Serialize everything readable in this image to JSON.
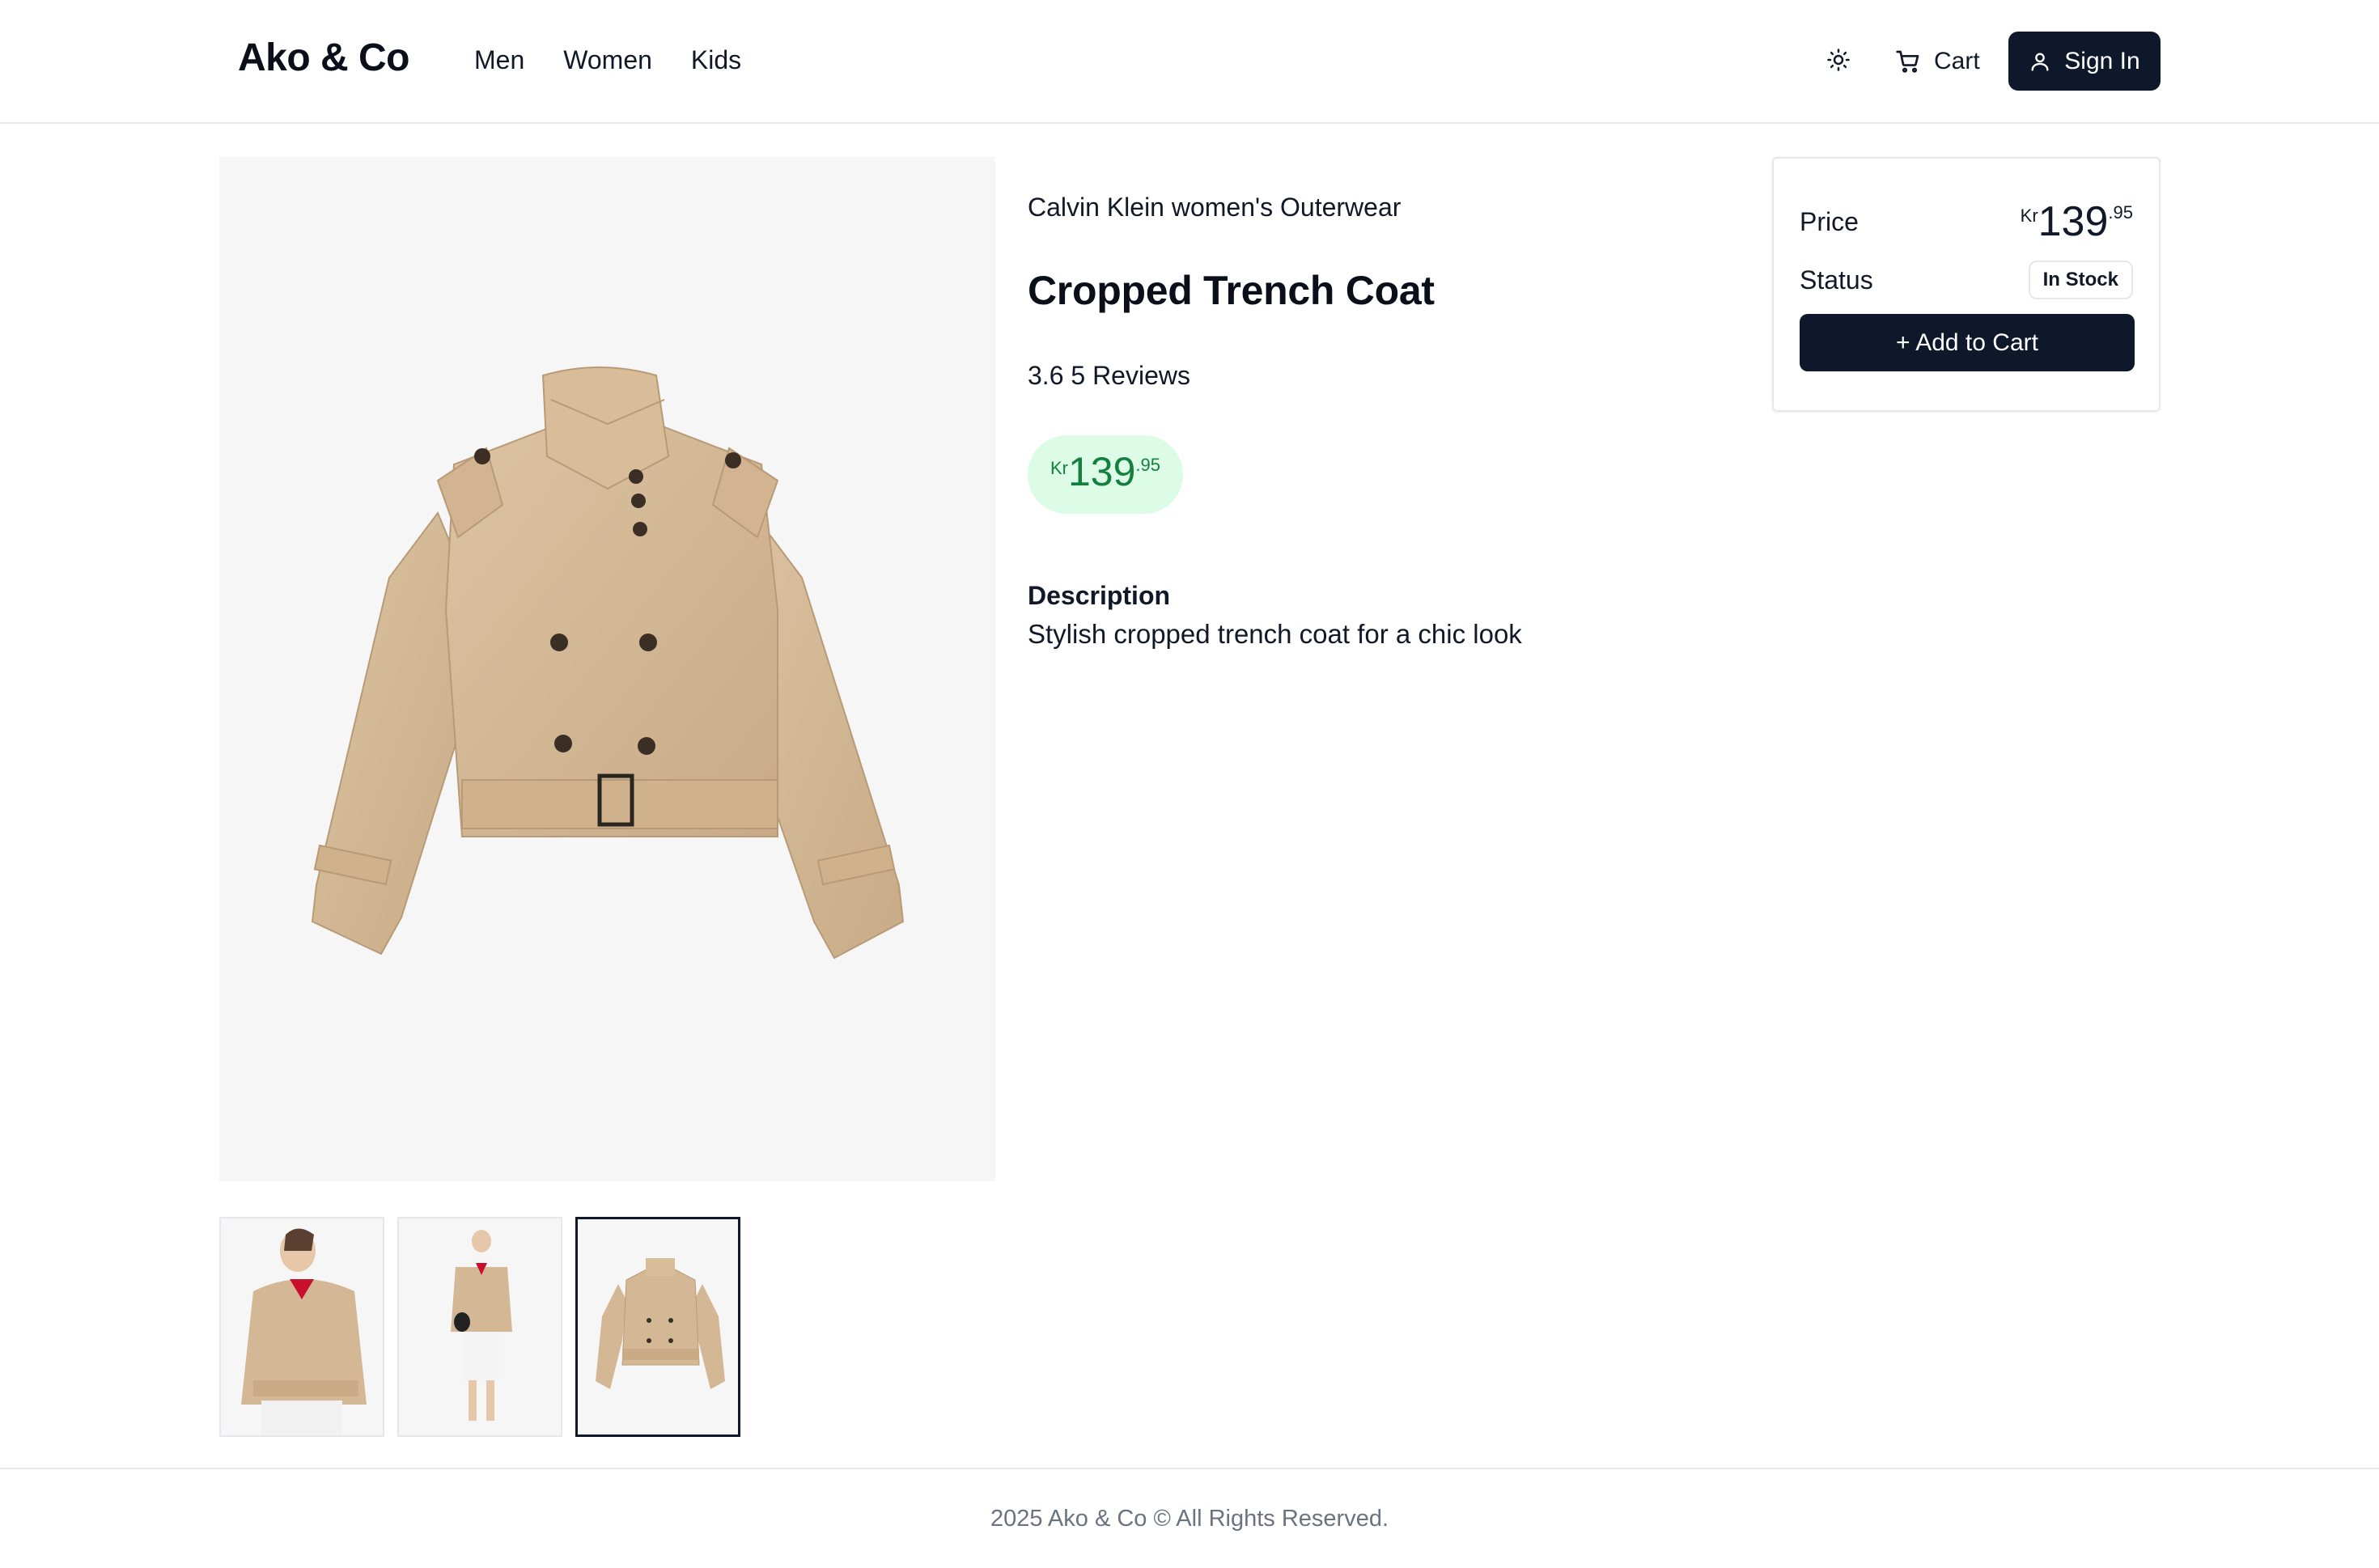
{
  "header": {
    "logo": "Ako & Co",
    "nav": [
      "Men",
      "Women",
      "Kids"
    ],
    "theme_icon": "sun-icon",
    "cart_label": "Cart",
    "cart_icon": "cart-icon",
    "signin_label": "Sign In",
    "signin_icon": "user-icon"
  },
  "product": {
    "brand_line": "Calvin Klein women's Outerwear",
    "title": "Cropped Trench Coat",
    "rating_text": "3.6 5 Reviews",
    "price": {
      "currency": "Kr",
      "whole": "139",
      "fraction": ".95"
    },
    "description_heading": "Description",
    "description": "Stylish cropped trench coat for a chic look"
  },
  "card": {
    "price_label": "Price",
    "price": {
      "currency": "Kr",
      "whole": "139",
      "fraction": ".95"
    },
    "status_label": "Status",
    "status_value": "In Stock",
    "add_to_cart": "+ Add to Cart"
  },
  "gallery": {
    "thumbnails": [
      "model-front",
      "model-full",
      "coat-flat"
    ],
    "active_index": 2
  },
  "footer": {
    "copyright": "2025 Ako & Co © All Rights Reserved."
  },
  "colors": {
    "primary": "#0f172a",
    "price_pill_bg": "#dcfce7",
    "price_pill_text": "#15803d",
    "coat": "#d4b896"
  }
}
